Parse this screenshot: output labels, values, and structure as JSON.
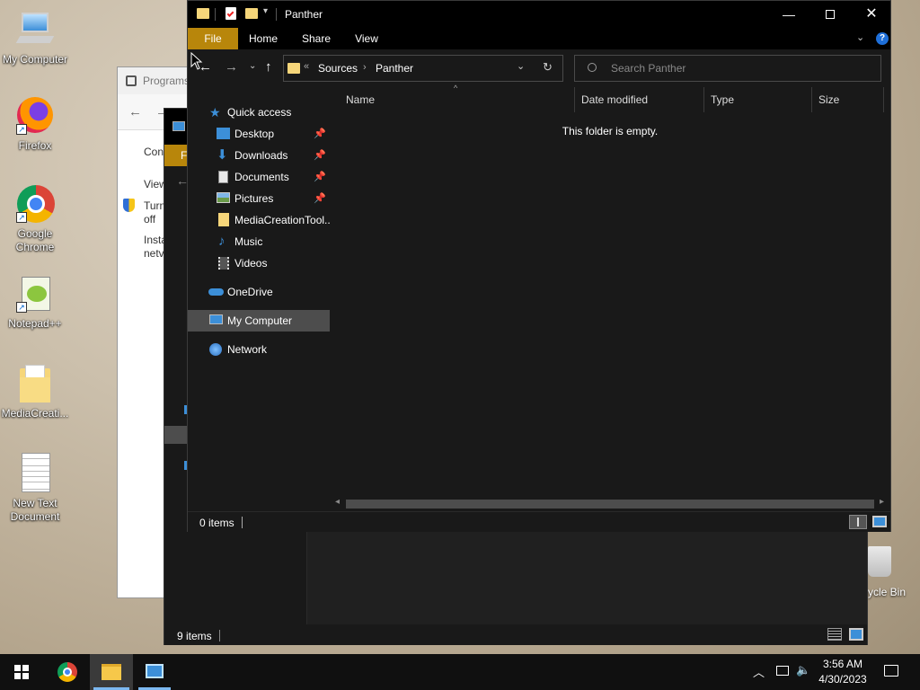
{
  "desktop": {
    "icons": [
      {
        "label": "My Computer"
      },
      {
        "label": "Firefox"
      },
      {
        "label": "Google Chrome"
      },
      {
        "label": "Notepad++"
      },
      {
        "label": "MediaCreati..."
      },
      {
        "label": "New Text Document"
      }
    ],
    "recycle_bin_label": "ycle Bin"
  },
  "back_window_1": {
    "title": "Programs",
    "lines": [
      "Con",
      "View",
      "Turn",
      "off",
      "Insta",
      "netv"
    ]
  },
  "back_window_2": {
    "tab_label": "F",
    "status": "9 items"
  },
  "explorer": {
    "title": "Panther",
    "ribbon_tabs": [
      "File",
      "Home",
      "Share",
      "View"
    ],
    "address": {
      "prefix": "«",
      "crumbs": [
        "Sources",
        "Panther"
      ]
    },
    "search_placeholder": "Search Panther",
    "nav": {
      "quick_access": "Quick access",
      "items": [
        "Desktop",
        "Downloads",
        "Documents",
        "Pictures",
        "MediaCreationTool...",
        "Music",
        "Videos"
      ],
      "onedrive": "OneDrive",
      "my_computer": "My Computer",
      "network": "Network"
    },
    "columns": [
      "Name",
      "Date modified",
      "Type",
      "Size"
    ],
    "empty_message": "This folder is empty.",
    "status": "0 items"
  },
  "taskbar": {
    "time": "3:56 AM",
    "date": "4/30/2023"
  },
  "colors": {
    "accent_file_tab": "#b8860b",
    "selection": "#4d4d4d"
  }
}
